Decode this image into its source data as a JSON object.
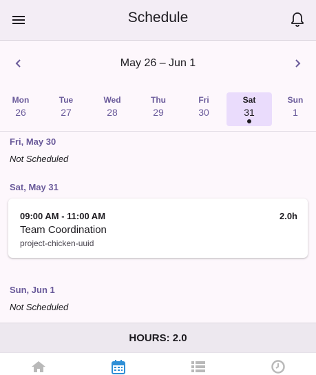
{
  "app_bar": {
    "title": "Schedule",
    "menu_icon": "hamburger-menu-icon",
    "notification_icon": "bell-icon"
  },
  "week_nav": {
    "range_label": "May 26 – Jun 1",
    "prev_icon": "chevron-left-icon",
    "next_icon": "chevron-right-icon"
  },
  "days": [
    {
      "name": "Mon",
      "num": "26",
      "selected": false,
      "has_event": false
    },
    {
      "name": "Tue",
      "num": "27",
      "selected": false,
      "has_event": false
    },
    {
      "name": "Wed",
      "num": "28",
      "selected": false,
      "has_event": false
    },
    {
      "name": "Thu",
      "num": "29",
      "selected": false,
      "has_event": false
    },
    {
      "name": "Fri",
      "num": "30",
      "selected": false,
      "has_event": false
    },
    {
      "name": "Sat",
      "num": "31",
      "selected": true,
      "has_event": true
    },
    {
      "name": "Sun",
      "num": "1",
      "selected": false,
      "has_event": false
    }
  ],
  "schedule": {
    "fri_label": "Fri, May 30",
    "fri_status": "Not Scheduled",
    "sat_label": "Sat, May 31",
    "sat_shift": {
      "time": "09:00 AM - 11:00 AM",
      "hours": "2.0h",
      "name": "Team Coordination",
      "project": "project-chicken-uuid"
    },
    "sun_label": "Sun, Jun 1",
    "sun_status": "Not Scheduled"
  },
  "summary": {
    "total_label": "HOURS: 2.0"
  },
  "bottom_nav": [
    {
      "icon": "home-icon",
      "active": false
    },
    {
      "icon": "calendar-icon",
      "active": true
    },
    {
      "icon": "list-icon",
      "active": false
    },
    {
      "icon": "clock-icon",
      "active": false
    }
  ],
  "colors": {
    "accent": "#6a5a9a",
    "selected_day_bg": "#eadcfc",
    "active_nav": "#2f8fd6",
    "inactive_nav": "#b9b9b9"
  }
}
